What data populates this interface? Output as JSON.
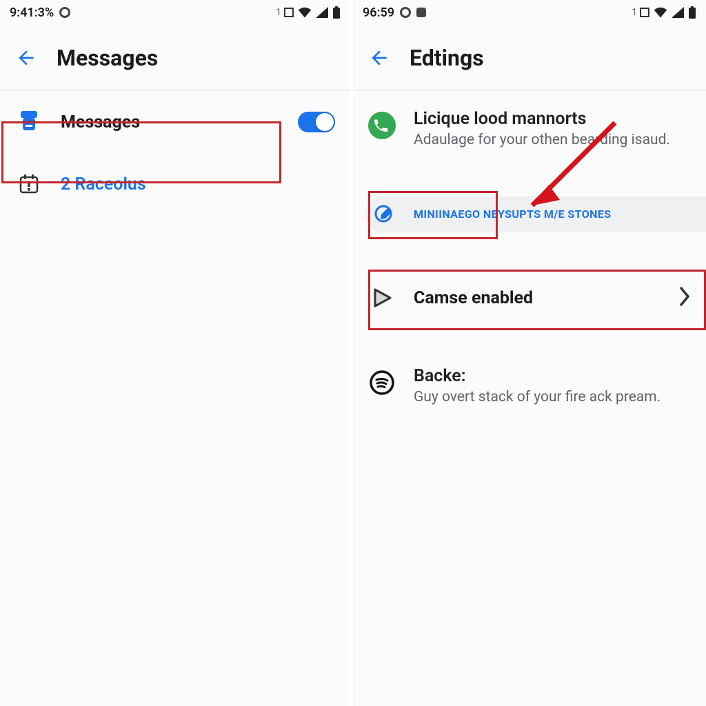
{
  "left": {
    "statusbar": {
      "time": "9:41:3%",
      "net_prefix": "1"
    },
    "title": "Messages",
    "rows": {
      "messages": {
        "label": "Messages"
      },
      "raceolus": {
        "label": "2 Raceolus"
      }
    }
  },
  "right": {
    "statusbar": {
      "time": "96:59",
      "net_prefix": "1"
    },
    "title": "Edtings",
    "licique": {
      "label": "Licique lood mannorts",
      "sub": "Adaulage for your othen bearding isaud."
    },
    "chip_text": "MINIINAEGO NEYSUPTS M/E STONES",
    "camse": {
      "label": "Camse enabled"
    },
    "backe": {
      "label": "Backe:",
      "sub": "Guy overt stack of your fire ack pream."
    }
  },
  "colors": {
    "accent": "#1a73e8",
    "danger": "#c1272d",
    "green": "#34a853"
  }
}
